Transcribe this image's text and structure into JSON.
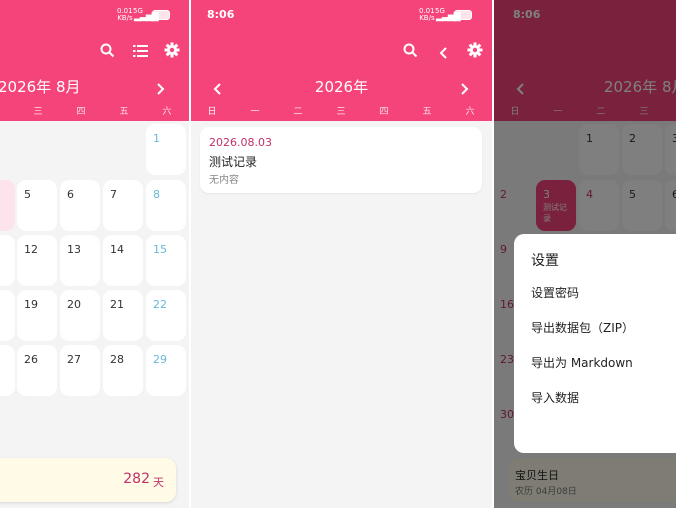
{
  "colors": {
    "primary": "#f5447a",
    "accent_text": "#c2306a",
    "weekend_blue": "#69b8d9",
    "background": "#f4f4f4"
  },
  "panel1": {
    "status": {
      "net_speed": "0.01\nKB/s",
      "net_type": "5G",
      "signal_icon": "signal-icon",
      "battery_icon": "battery-icon"
    },
    "toolbar": {
      "search_icon": "search-icon",
      "list_icon": "list-icon",
      "settings_icon": "gear-icon"
    },
    "month_title": "2026年 8月",
    "next_icon": "chevron-right-icon",
    "weekdays": [
      "三",
      "四",
      "五",
      "六"
    ],
    "day_numbers": {
      "r1c4": "1",
      "r2c1": "5",
      "r2c2": "6",
      "r2c3": "7",
      "r2c4": "8",
      "r3c1": "12",
      "r3c2": "13",
      "r3c3": "14",
      "r3c4": "15",
      "r4c1": "19",
      "r4c2": "20",
      "r4c3": "21",
      "r4c4": "22",
      "r5c1": "26",
      "r5c2": "27",
      "r5c3": "28",
      "r5c4": "29"
    },
    "countdown": {
      "value": "282",
      "unit": "天"
    }
  },
  "panel2": {
    "time": "8:06",
    "status": {
      "net_speed": "0.01\nKB/s",
      "net_type": "5G",
      "signal_icon": "signal-icon",
      "battery_icon": "battery-icon"
    },
    "toolbar": {
      "search_icon": "search-icon",
      "back_icon": "chevron-left-icon",
      "settings_icon": "gear-icon"
    },
    "year_title": "2026年",
    "prev_icon": "chevron-left-icon",
    "next_icon": "chevron-right-icon",
    "weekdays": [
      "日",
      "一",
      "二",
      "三",
      "四",
      "五",
      "六"
    ],
    "record": {
      "date": "2026.08.03",
      "title": "测试记录",
      "content": "无内容"
    }
  },
  "panel3": {
    "time": "8:06",
    "month_title": "2026年 8月",
    "prev_icon": "chevron-left-icon",
    "weekdays": [
      "日",
      "一",
      "二",
      "三"
    ],
    "day_numbers": {
      "r1c2": "1",
      "r1c3": "2",
      "r1c4": "3",
      "r2c1": "2",
      "r2c2": "3",
      "r2c3": "4",
      "r2c4": "5",
      "r2c5": "6",
      "r3c1": "9",
      "r4c1": "16",
      "r5c1": "23",
      "r6c1": "30"
    },
    "selected_event": "测试记\n录",
    "settings_dialog": {
      "title": "设置",
      "items": [
        "设置密码",
        "导出数据包（ZIP）",
        "导出为 Markdown",
        "导入数据"
      ]
    },
    "birthday_card": {
      "title": "宝贝生日",
      "subtitle": "农历 04月08日"
    }
  }
}
